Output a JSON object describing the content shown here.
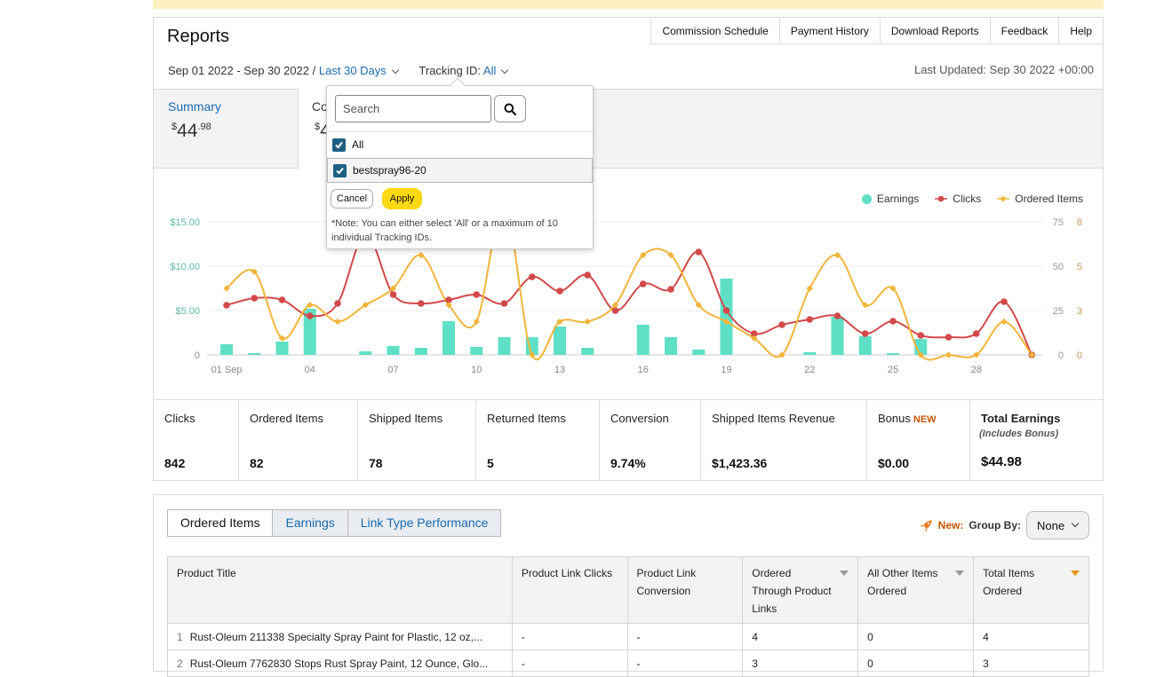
{
  "header": {
    "title": "Reports",
    "links": [
      "Commission Schedule",
      "Payment History",
      "Download Reports",
      "Feedback",
      "Help"
    ],
    "date_range": "Sep 01 2022 - Sep 30 2022",
    "separator": "/",
    "period_link": "Last 30 Days",
    "tracking_label": "Tracking ID:",
    "tracking_value": "All",
    "last_updated": "Last Updated: Sep 30 2022 +00:00"
  },
  "summary_tabs": {
    "summary_label": "Summary",
    "summary_dollar": "$",
    "summary_whole": "44",
    "summary_cents": ".98",
    "second_label": "Co",
    "second_dollar": "$",
    "second_whole": "4"
  },
  "legend": {
    "earnings": "Earnings",
    "clicks": "Clicks",
    "ordered_items": "Ordered Items"
  },
  "colors": {
    "earnings": "#5ee0c6",
    "clicks": "#d24949",
    "ordered_items": "#f2b53a",
    "link": "#1a6ab0",
    "apply_button": "#ffd814",
    "new_badge": "#c45500"
  },
  "chart_data": {
    "type": "bar",
    "x": [
      "01 Sep",
      "02",
      "03",
      "04",
      "05",
      "06",
      "07",
      "08",
      "09",
      "10",
      "11",
      "12",
      "13",
      "14",
      "15",
      "16",
      "17",
      "18",
      "19",
      "20",
      "21",
      "22",
      "23",
      "24",
      "25",
      "26",
      "27",
      "28",
      "29",
      "30"
    ],
    "x_tick_labels": [
      "01 Sep",
      "04",
      "07",
      "10",
      "13",
      "16",
      "19",
      "22",
      "25",
      "28"
    ],
    "series": [
      {
        "name": "Earnings",
        "type": "bar",
        "axis": "left",
        "values": [
          1.2,
          0.2,
          1.5,
          5.2,
          0,
          0.4,
          1.0,
          0.8,
          3.8,
          0.9,
          2.0,
          2.0,
          3.2,
          0.8,
          0,
          3.4,
          2.0,
          0.6,
          8.6,
          0,
          0,
          0.3,
          4.3,
          2.1,
          0.2,
          1.8,
          0,
          0,
          0,
          0
        ]
      },
      {
        "name": "Clicks",
        "type": "line",
        "axis": "right",
        "values": [
          28,
          32,
          31,
          22,
          29,
          68,
          34,
          29,
          31,
          34,
          29,
          44,
          36,
          45,
          25,
          40,
          37,
          58,
          25,
          12,
          17,
          20,
          22,
          12,
          19,
          11,
          10,
          12,
          30,
          0
        ]
      },
      {
        "name": "Ordered Items",
        "type": "line",
        "axis": "right2",
        "values": [
          4,
          5,
          1,
          3,
          2,
          3,
          4,
          6,
          3,
          2,
          9,
          0,
          2,
          2,
          3,
          6,
          6,
          3,
          2,
          1,
          0,
          4,
          6,
          3,
          4,
          0,
          0,
          0,
          2,
          0
        ]
      }
    ],
    "y_left": {
      "ticks": [
        "0",
        "$5.00",
        "$10.00",
        "$15.00"
      ],
      "range": [
        0,
        15
      ]
    },
    "y_right": {
      "ticks": [
        "0",
        "25",
        "50",
        "75"
      ],
      "range": [
        0,
        75
      ]
    },
    "y_right2": {
      "ticks": [
        "0",
        "3",
        "5",
        "8"
      ],
      "range": [
        0,
        8
      ]
    },
    "legend_position": "top-right",
    "grid": "horizontal"
  },
  "stats": [
    {
      "label": "Clicks",
      "value": "842"
    },
    {
      "label": "Ordered Items",
      "value": "82"
    },
    {
      "label": "Shipped Items",
      "value": "78"
    },
    {
      "label": "Returned Items",
      "value": "5"
    },
    {
      "label": "Conversion",
      "value": "9.74%"
    },
    {
      "label": "Shipped Items Revenue",
      "value": "$1,423.36"
    },
    {
      "label": "Bonus",
      "badge": "NEW",
      "value": "$0.00"
    },
    {
      "label": "Total Earnings",
      "sub": "(Includes Bonus)",
      "value": "$44.98"
    }
  ],
  "table_section": {
    "tabs": [
      "Ordered Items",
      "Earnings",
      "Link Type Performance"
    ],
    "new_label": "New:",
    "group_by_label": "Group By:",
    "group_by_value": "None",
    "columns": [
      "Product Title",
      "Product Link Clicks",
      "Product Link Conversion",
      "Ordered Through Product Links",
      "All Other Items Ordered",
      "Total Items Ordered"
    ],
    "rows": [
      {
        "num": "1",
        "title": "Rust-Oleum 211338 Specialty Spray Paint for Plastic, 12 oz,...",
        "clicks": "-",
        "conversion": "-",
        "through": "4",
        "other": "0",
        "total": "4"
      },
      {
        "num": "2",
        "title": "Rust-Oleum 7762830 Stops Rust Spray Paint, 12 Ounce, Glo...",
        "clicks": "-",
        "conversion": "-",
        "through": "3",
        "other": "0",
        "total": "3"
      }
    ]
  },
  "tracking_popup": {
    "search_placeholder": "Search",
    "options": [
      {
        "label": "All",
        "checked": true
      },
      {
        "label": "bestspray96-20",
        "checked": true
      }
    ],
    "cancel": "Cancel",
    "apply": "Apply",
    "note": "*Note: You can either select 'All' or a maximum of 10 individual Tracking IDs."
  }
}
